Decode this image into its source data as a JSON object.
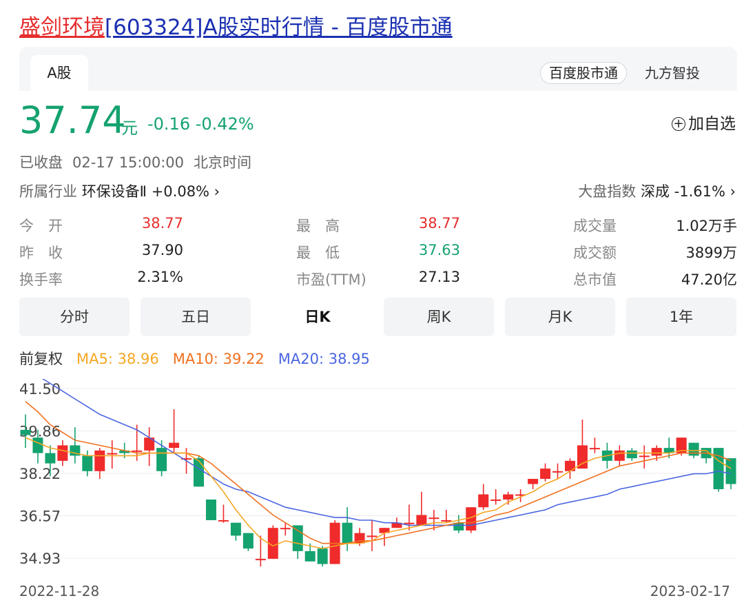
{
  "page_title": {
    "part1": "盛剑环境",
    "part2": "[603324]A股实时行情 - 百度股市通"
  },
  "tabs": {
    "active": "A股",
    "source1": "百度股市通",
    "source2": "九方智投"
  },
  "quote": {
    "price": "37.74",
    "unit": "元",
    "change": "-0.16 -0.42%",
    "watchlist": "加自选"
  },
  "status": {
    "state": "已收盘",
    "time": "02-17 15:00:00",
    "tz": "北京时间"
  },
  "industry": {
    "label": "所属行业",
    "name": "环保设备Ⅱ +0.08% ›"
  },
  "market_index": {
    "label": "大盘指数",
    "name": "深成 -1.61% ›"
  },
  "stats": [
    {
      "label": "今　开",
      "value": "38.77",
      "color": "red"
    },
    {
      "label": "昨　收",
      "value": "37.90",
      "color": ""
    },
    {
      "label": "换手率",
      "value": "2.31%",
      "color": ""
    },
    {
      "label": "最　高",
      "value": "38.77",
      "color": "red"
    },
    {
      "label": "最　低",
      "value": "37.63",
      "color": "green"
    },
    {
      "label": "市盈(TTM)",
      "value": "27.13",
      "color": ""
    },
    {
      "label": "成交量",
      "value": "1.02万手",
      "color": ""
    },
    {
      "label": "成交额",
      "value": "3899万",
      "color": ""
    },
    {
      "label": "总市值",
      "value": "47.20亿",
      "color": ""
    }
  ],
  "period_tabs": [
    "分时",
    "五日",
    "日K",
    "周K",
    "月K",
    "1年"
  ],
  "selected_period": "日K",
  "ma_legend": {
    "adjust": "前复权",
    "ma5": "MA5: 38.96",
    "ma10": "MA10: 39.22",
    "ma20": "MA20: 38.95",
    "ma5_color": "#f5a623",
    "ma10_color": "#f07020",
    "ma20_color": "#4a66e0"
  },
  "colors": {
    "up": "#f02b2b",
    "down": "#14a26e"
  },
  "chart_data": {
    "type": "candlestick",
    "y_ticks": [
      "41.50",
      "39.86",
      "38.22",
      "36.57",
      "34.93"
    ],
    "ylim": [
      34.93,
      41.5
    ],
    "x_start": "2022-11-28",
    "x_end": "2023-02-17",
    "candles": [
      {
        "o": 39.9,
        "c": 39.7,
        "h": 40.5,
        "l": 39.2
      },
      {
        "o": 39.6,
        "c": 39.0,
        "h": 39.9,
        "l": 38.6
      },
      {
        "o": 39.0,
        "c": 38.6,
        "h": 39.3,
        "l": 38.1
      },
      {
        "o": 38.7,
        "c": 39.3,
        "h": 39.5,
        "l": 38.5
      },
      {
        "o": 39.3,
        "c": 38.9,
        "h": 40.0,
        "l": 38.6
      },
      {
        "o": 38.9,
        "c": 38.3,
        "h": 39.1,
        "l": 38.1
      },
      {
        "o": 38.3,
        "c": 39.1,
        "h": 39.2,
        "l": 38.0
      },
      {
        "o": 39.0,
        "c": 39.0,
        "h": 39.5,
        "l": 38.4
      },
      {
        "o": 39.1,
        "c": 39.0,
        "h": 39.4,
        "l": 38.8
      },
      {
        "o": 39.1,
        "c": 39.1,
        "h": 40.1,
        "l": 38.7
      },
      {
        "o": 39.1,
        "c": 39.6,
        "h": 40.0,
        "l": 38.5
      },
      {
        "o": 39.2,
        "c": 38.3,
        "h": 39.5,
        "l": 38.1
      },
      {
        "o": 39.2,
        "c": 39.4,
        "h": 40.7,
        "l": 39.0
      },
      {
        "o": 38.8,
        "c": 38.8,
        "h": 39.2,
        "l": 38.2
      },
      {
        "o": 38.8,
        "c": 37.7,
        "h": 38.9,
        "l": 37.7
      },
      {
        "o": 37.2,
        "c": 36.4,
        "h": 37.2,
        "l": 36.4
      },
      {
        "o": 36.4,
        "c": 36.4,
        "h": 37.0,
        "l": 36.3
      },
      {
        "o": 36.3,
        "c": 35.8,
        "h": 36.3,
        "l": 35.6
      },
      {
        "o": 35.9,
        "c": 35.3,
        "h": 35.9,
        "l": 35.2
      },
      {
        "o": 34.9,
        "c": 34.9,
        "h": 35.8,
        "l": 34.6
      },
      {
        "o": 34.9,
        "c": 36.1,
        "h": 36.2,
        "l": 34.9
      },
      {
        "o": 36.1,
        "c": 36.1,
        "h": 36.3,
        "l": 35.8
      },
      {
        "o": 36.2,
        "c": 35.2,
        "h": 36.2,
        "l": 34.9
      },
      {
        "o": 35.2,
        "c": 34.8,
        "h": 35.5,
        "l": 34.8
      },
      {
        "o": 35.3,
        "c": 34.7,
        "h": 35.4,
        "l": 34.6
      },
      {
        "o": 34.7,
        "c": 36.3,
        "h": 36.4,
        "l": 34.7
      },
      {
        "o": 36.3,
        "c": 35.5,
        "h": 36.9,
        "l": 35.2
      },
      {
        "o": 35.5,
        "c": 35.9,
        "h": 36.1,
        "l": 35.4
      },
      {
        "o": 35.8,
        "c": 35.8,
        "h": 36.4,
        "l": 35.2
      },
      {
        "o": 35.9,
        "c": 36.1,
        "h": 36.1,
        "l": 35.4
      },
      {
        "o": 36.1,
        "c": 36.3,
        "h": 36.5,
        "l": 36.1
      },
      {
        "o": 36.3,
        "c": 36.3,
        "h": 37.0,
        "l": 36.0
      },
      {
        "o": 36.2,
        "c": 36.6,
        "h": 37.5,
        "l": 36.2
      },
      {
        "o": 36.5,
        "c": 36.5,
        "h": 36.8,
        "l": 36.0
      },
      {
        "o": 36.4,
        "c": 36.4,
        "h": 36.8,
        "l": 36.3
      },
      {
        "o": 36.3,
        "c": 36.0,
        "h": 36.6,
        "l": 35.9
      },
      {
        "o": 36.0,
        "c": 36.9,
        "h": 36.9,
        "l": 35.9
      },
      {
        "o": 36.9,
        "c": 37.4,
        "h": 37.8,
        "l": 36.8
      },
      {
        "o": 37.2,
        "c": 37.2,
        "h": 37.6,
        "l": 37.0
      },
      {
        "o": 37.2,
        "c": 37.4,
        "h": 37.5,
        "l": 37.0
      },
      {
        "o": 37.4,
        "c": 37.4,
        "h": 37.6,
        "l": 37.1
      },
      {
        "o": 37.8,
        "c": 38.0,
        "h": 38.0,
        "l": 37.6
      },
      {
        "o": 38.0,
        "c": 38.4,
        "h": 38.6,
        "l": 37.9
      },
      {
        "o": 38.3,
        "c": 38.3,
        "h": 38.6,
        "l": 38.0
      },
      {
        "o": 38.3,
        "c": 38.7,
        "h": 38.8,
        "l": 38.0
      },
      {
        "o": 38.4,
        "c": 39.3,
        "h": 40.3,
        "l": 38.4
      },
      {
        "o": 39.2,
        "c": 39.2,
        "h": 39.6,
        "l": 39.0
      },
      {
        "o": 39.1,
        "c": 38.7,
        "h": 39.4,
        "l": 38.4
      },
      {
        "o": 38.7,
        "c": 39.1,
        "h": 39.3,
        "l": 38.5
      },
      {
        "o": 39.1,
        "c": 38.8,
        "h": 39.2,
        "l": 38.7
      },
      {
        "o": 38.9,
        "c": 38.9,
        "h": 39.3,
        "l": 38.4
      },
      {
        "o": 38.9,
        "c": 39.2,
        "h": 39.3,
        "l": 38.7
      },
      {
        "o": 39.2,
        "c": 39.0,
        "h": 39.6,
        "l": 38.8
      },
      {
        "o": 39.0,
        "c": 39.6,
        "h": 39.6,
        "l": 38.9
      },
      {
        "o": 39.4,
        "c": 38.9,
        "h": 39.4,
        "l": 38.8
      },
      {
        "o": 39.2,
        "c": 38.8,
        "h": 39.2,
        "l": 38.6
      },
      {
        "o": 39.2,
        "c": 37.6,
        "h": 39.2,
        "l": 37.5
      },
      {
        "o": 38.8,
        "c": 37.8,
        "h": 38.8,
        "l": 37.6
      }
    ],
    "ma5": [
      39.6,
      39.4,
      39.2,
      39.1,
      39.0,
      38.9,
      38.9,
      38.9,
      38.9,
      38.9,
      39.0,
      39.0,
      39.0,
      39.0,
      38.7,
      38.1,
      37.5,
      36.8,
      36.2,
      35.7,
      35.4,
      35.6,
      35.5,
      35.4,
      35.3,
      35.4,
      35.5,
      35.5,
      35.6,
      35.9,
      36.0,
      36.1,
      36.2,
      36.3,
      36.3,
      36.4,
      36.5,
      36.7,
      36.8,
      37.1,
      37.3,
      37.5,
      37.8,
      38.0,
      38.3,
      38.6,
      38.8,
      38.9,
      39.0,
      39.0,
      39.0,
      39.0,
      39.0,
      39.1,
      39.1,
      39.1,
      38.7,
      38.4
    ],
    "ma10": [
      41.0,
      40.6,
      40.1,
      39.8,
      39.5,
      39.4,
      39.3,
      39.2,
      39.1,
      39.0,
      39.0,
      39.0,
      39.0,
      39.0,
      38.9,
      38.6,
      38.2,
      37.8,
      37.4,
      37.0,
      36.6,
      36.3,
      36.0,
      35.7,
      35.5,
      35.5,
      35.5,
      35.6,
      35.6,
      35.7,
      35.8,
      35.9,
      36.0,
      36.1,
      36.2,
      36.3,
      36.3,
      36.4,
      36.6,
      36.7,
      36.9,
      37.1,
      37.3,
      37.5,
      37.7,
      37.9,
      38.1,
      38.3,
      38.5,
      38.6,
      38.7,
      38.8,
      38.9,
      39.0,
      39.0,
      39.0,
      38.9,
      38.7
    ],
    "ma20": [
      42.2,
      42.0,
      41.7,
      41.4,
      41.1,
      40.8,
      40.5,
      40.3,
      40.1,
      39.9,
      39.6,
      39.3,
      39.0,
      38.7,
      38.4,
      38.1,
      37.8,
      37.6,
      37.5,
      37.3,
      37.1,
      36.9,
      36.8,
      36.7,
      36.6,
      36.5,
      36.5,
      36.4,
      36.4,
      36.3,
      36.3,
      36.2,
      36.2,
      36.2,
      36.2,
      36.2,
      36.2,
      36.3,
      36.4,
      36.5,
      36.6,
      36.7,
      36.8,
      37.0,
      37.1,
      37.2,
      37.3,
      37.4,
      37.6,
      37.7,
      37.8,
      37.9,
      38.0,
      38.1,
      38.2,
      38.2,
      38.3,
      38.2
    ]
  }
}
